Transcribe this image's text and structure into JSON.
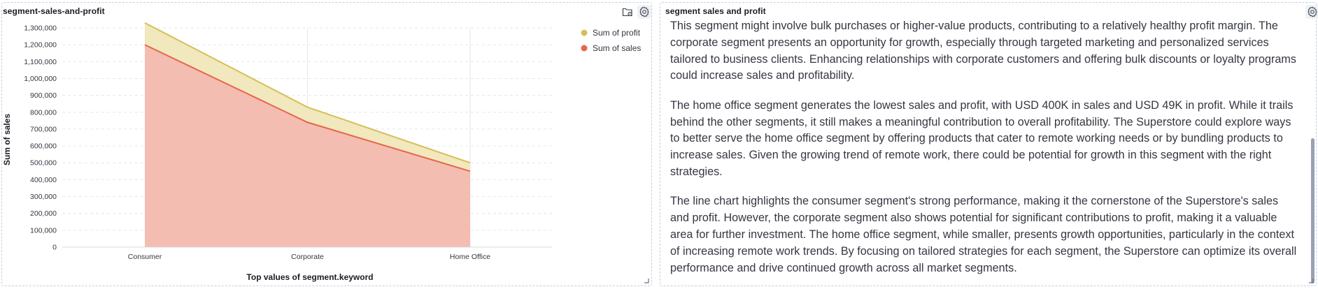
{
  "left_panel": {
    "title": "segment-sales-and-profit",
    "icons": {
      "folder": "folder-cog-icon",
      "gear": "gear-icon"
    }
  },
  "right_panel": {
    "title": "segment sales and profit",
    "paragraphs": [
      "This segment might involve bulk purchases or higher-value products, contributing to a relatively healthy profit margin. The corporate segment presents an opportunity for growth, especially through targeted marketing and personalized services tailored to business clients. Enhancing relationships with corporate customers and offering bulk discounts or loyalty programs could increase sales and profitability.",
      "The home office segment generates the lowest sales and profit, with USD 400K in sales and USD 49K in profit. While it trails behind the other segments, it still makes a meaningful contribution to overall profitability. The Superstore could explore ways to better serve the home office segment by offering products that cater to remote working needs or by bundling products to increase sales. Given the growing trend of remote work, there could be potential for growth in this segment with the right strategies.",
      "The line chart highlights the consumer segment's strong performance, making it the cornerstone of the Superstore's sales and profit. However, the corporate segment also shows potential for significant contributions to profit, making it a valuable area for further investment. The home office segment, while smaller, presents growth opportunities, particularly in the context of increasing remote work trends. By focusing on tailored strategies for each segment, the Superstore can optimize its overall performance and drive continued growth across all market segments."
    ],
    "icons": {
      "gear": "gear-icon"
    }
  },
  "chart_data": {
    "type": "area",
    "stacked": true,
    "categories": [
      "Consumer",
      "Corporate",
      "Home Office"
    ],
    "series": [
      {
        "name": "Sum of sales",
        "values": [
          1200000,
          740000,
          450000
        ],
        "color": "#e7664c",
        "fill": "#f4bdb2"
      },
      {
        "name": "Sum of profit",
        "values": [
          130000,
          90000,
          50000
        ],
        "color": "#d6bf57",
        "fill": "#f1e8bd"
      }
    ],
    "legend_order": [
      "Sum of profit",
      "Sum of sales"
    ],
    "xlabel": "Top values of segment.keyword",
    "ylabel": "Sum of sales",
    "ylim": [
      0,
      1300000
    ],
    "yticks": [
      0,
      100000,
      200000,
      300000,
      400000,
      500000,
      600000,
      700000,
      800000,
      900000,
      1000000,
      1100000,
      1200000,
      1300000
    ],
    "ytick_labels": [
      "0",
      "100,000",
      "200,000",
      "300,000",
      "400,000",
      "500,000",
      "600,000",
      "700,000",
      "800,000",
      "900,000",
      "1,000,000",
      "1,100,000",
      "1,200,000",
      "1,300,000"
    ],
    "grid": true,
    "legend_position": "top-right"
  }
}
